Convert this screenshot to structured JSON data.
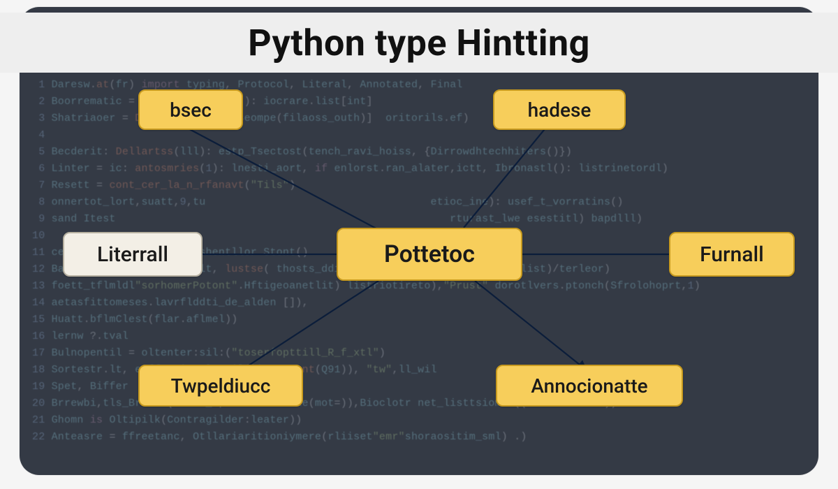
{
  "title": "Python type Hintting",
  "diagram": {
    "center": {
      "label": "Pottetoc"
    },
    "nodes": {
      "top_left": {
        "label": "bsec"
      },
      "top_right": {
        "label": "hadese"
      },
      "left": {
        "label": "Literrall"
      },
      "right": {
        "label": "Furnall"
      },
      "bottom_left": {
        "label": "Twpeldiucc"
      },
      "bottom_right": {
        "label": "Annocionatte"
      }
    }
  },
  "colors": {
    "node_fill": "#f7ce5b",
    "node_border": "#c79a1f",
    "node_light_fill": "#f3efe6",
    "canvas_bg": "#343a45",
    "title_bg": "#eeeeee"
  }
}
